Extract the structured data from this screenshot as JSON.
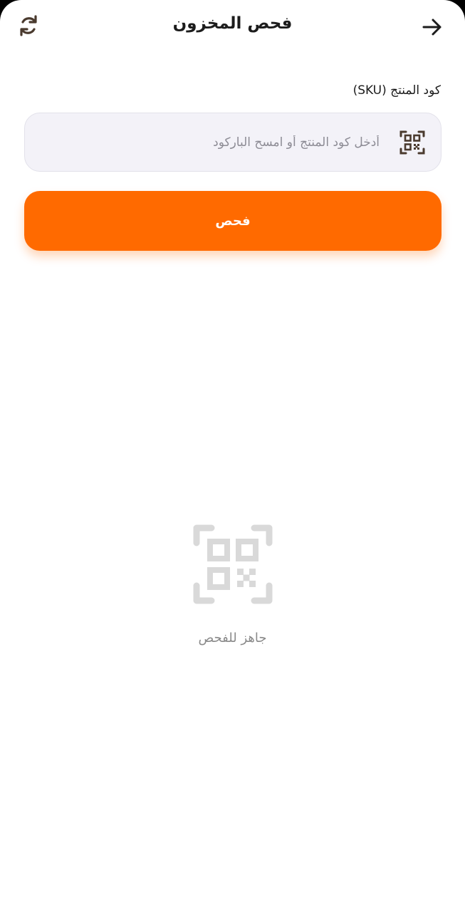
{
  "header": {
    "title": "فحص المخزون",
    "back_icon": "arrow-right-icon",
    "refresh_icon": "refresh-icon"
  },
  "form": {
    "sku_label": "كود المنتج (SKU)",
    "sku_placeholder": "أدخل كود المنتج أو امسح الباركود",
    "sku_value": "",
    "scan_icon": "qr-scan-icon",
    "check_button_label": "فحص"
  },
  "empty_state": {
    "icon": "qr-code-icon",
    "message": "جاهز للفحص"
  },
  "colors": {
    "accent": "#ff6a00",
    "input_bg": "#f3f2f8",
    "icon_dark": "#4a3a2e",
    "empty_icon": "#d9d9d9"
  }
}
